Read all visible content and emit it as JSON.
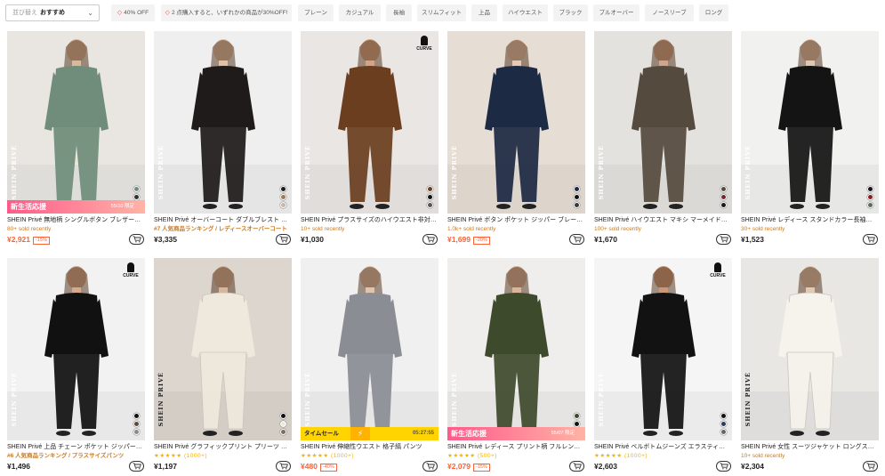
{
  "sort": {
    "label": "並び替え",
    "value": "おすすめ"
  },
  "filter_chips": [
    "40% OFF",
    "2 点購入すると、いずれかの商品が30%OFF!",
    "プレーン",
    "カジュアル",
    "長袖",
    "スリムフィット",
    "上品",
    "ハイウエスト",
    "ブラック",
    "プルオーバー",
    "ノースリーブ",
    "ロング"
  ],
  "products": [
    {
      "title": "SHEIN Privé 無地柄 シングルボタン ブレザー…",
      "meta": "80+ sold recently",
      "price": "¥2,921",
      "discount": "-15%",
      "banner": "新生活応援",
      "banner_sub": "55/10 限定",
      "brand_mark": "SHEIN PRIVÉ",
      "photo": {
        "bg": "#e9e6e2",
        "garment": "#6f8d7a",
        "skin": "#d9b89b",
        "swatches": [
          "#6f8d7a",
          "#333333",
          "#b3222e"
        ]
      }
    },
    {
      "title": "SHEIN Privé オーバーコート ダブルブレスト …",
      "meta": "#7 人気商品ランキング / レディースオーバーコート",
      "price": "¥3,335",
      "brand_mark": "SHEIN PRIVÉ",
      "photo": {
        "bg": "#efefef",
        "garment": "#1e1b1a",
        "skin": "#e0c1a6",
        "swatches": [
          "#1e1b1a",
          "#9a7a5c",
          "#c9b79f"
        ]
      }
    },
    {
      "title": "SHEIN Privé プラスサイズのハイウエスト非対…",
      "meta": "10+ sold recently",
      "price": "¥1,030",
      "curve": "CURVE",
      "brand_mark": "SHEIN PRIVÉ",
      "photo": {
        "bg": "#eae6e3",
        "garment": "#6b3e1f",
        "skin": "#d4a486",
        "swatches": [
          "#6b3e1f",
          "#111111",
          "#555555"
        ]
      }
    },
    {
      "title": "SHEIN Privé ボタン ポケット ジッパー ブレー…",
      "meta": "1.0k+ sold recently",
      "price": "¥1,699",
      "discount": "-20%",
      "brand_mark": "SHEIN PRIVÉ",
      "photo": {
        "bg": "#e6ddd4",
        "garment": "#1d2a44",
        "skin": "#e6c8b3",
        "swatches": [
          "#1d2a44",
          "#111111",
          "#3a3a3a"
        ]
      }
    },
    {
      "title": "SHEIN Privé ハイウエスト マキシ マーメイド…",
      "meta": "100+ sold recently",
      "price": "¥1,670",
      "brand_mark": "SHEIN PRIVÉ",
      "photo": {
        "bg": "#e4e2df",
        "garment": "#554a3e",
        "skin": "#cfa58c",
        "swatches": [
          "#554a3e",
          "#7a2630",
          "#1a1a1a"
        ]
      }
    },
    {
      "title": "SHEIN Privé レディース スタンドカラー長袖…",
      "meta": "30+ sold recently",
      "price": "¥1,523",
      "brand_mark": "SHEIN PRIVÉ",
      "photo": {
        "bg": "#f1f1ef",
        "garment": "#141414",
        "skin": "#e2c6b0",
        "swatches": [
          "#141414",
          "#8c1c26",
          "#5d6b5a"
        ]
      }
    },
    {
      "title": "SHEIN Privé 上品 チェーン ポケット ジッパー…",
      "meta": "#6 人気商品ランキング / プラスサイズパンツ",
      "price": "¥1,496",
      "curve": "CURVE",
      "brand_mark": "SHEIN PRIVÉ",
      "photo": {
        "bg": "#f2f2f2",
        "garment": "#111111",
        "skin": "#d5a98e",
        "swatches": [
          "#111111",
          "#5a4a3a",
          "#8a8a8a"
        ]
      }
    },
    {
      "title": "SHEIN Privé グラフィックプリント プリーツ …",
      "meta": "★★★★★ (1000+)",
      "price": "¥1,197",
      "brand_mark": "SHEIN PRIVÉ",
      "photo": {
        "bg": "#dcd6cf",
        "garment": "#efe9dd",
        "skin": "#d7b59c",
        "swatches": [
          "#111111",
          "#efe9dd",
          "#7d6d5a"
        ]
      }
    },
    {
      "title": "SHEIN Privé 伸縮性ウエスト 格子縞 パンツ",
      "meta": "★★★★★ (1000+)",
      "price": "¥480",
      "discount": "-40%",
      "banner": "タイムセール",
      "banner_timer": "05:27:55",
      "brand_mark": "SHEIN PRIVÉ",
      "photo": {
        "bg": "#f0f0f0",
        "garment": "#8b8d94",
        "skin": "#e1c4ae",
        "swatches": []
      }
    },
    {
      "title": "SHEIN Privé レディース プリント柄 フルレン…",
      "meta": "★★★★★ (500+)",
      "price": "¥2,079",
      "discount": "-15%",
      "banner": "新生活応援",
      "banner_sub": "55/07 限定",
      "brand_mark": "SHEIN PRIVÉ",
      "photo": {
        "bg": "#efeeec",
        "garment": "#3e4a2c",
        "skin": "#d8b59b",
        "swatches": [
          "#3e4a2c",
          "#111111",
          "#6d5a44"
        ]
      }
    },
    {
      "title": "SHEIN Privé ベルボトムジーンズ エラスティ…",
      "meta": "★★★★★ (1000+)",
      "price": "¥2,603",
      "curve": "CURVE",
      "brand_mark": "SHEIN PRIVÉ",
      "photo": {
        "bg": "#f5f5f5",
        "garment": "#121212",
        "skin": "#c99878",
        "swatches": [
          "#121212",
          "#2d3b57",
          "#666666"
        ]
      }
    },
    {
      "title": "SHEIN Privé 女性 スーツジャケット ロングス…",
      "meta": "10+ sold recently",
      "price": "¥2,304",
      "brand_mark": "SHEIN PRIVÉ",
      "photo": {
        "bg": "#e9e7e4",
        "garment": "#f6f3ec",
        "skin": "#e2c9b4",
        "swatches": []
      }
    }
  ]
}
